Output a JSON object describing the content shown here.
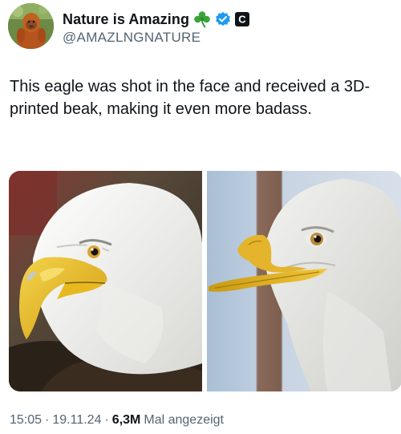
{
  "author": {
    "display_name": "Nature is Amazing",
    "handle": "@AMAZLNGNATURE",
    "clover_emoji": "☘️",
    "verified_icon": "verified-badge-icon",
    "affiliate_icon": "affiliate-c-badge-icon",
    "affiliate_letter": "C",
    "verified_color": "#1d9bf0"
  },
  "tweet": {
    "text": "This eagle was shot in the face and received a 3D-printed beak, making it even more badass."
  },
  "media": {
    "images": [
      "eagle-original-photo",
      "eagle-3d-printed-beak-photo"
    ]
  },
  "meta": {
    "time": "15:05",
    "date": "19.11.24",
    "separator": "·",
    "views": "6,3M",
    "views_label": "Mal angezeigt"
  }
}
